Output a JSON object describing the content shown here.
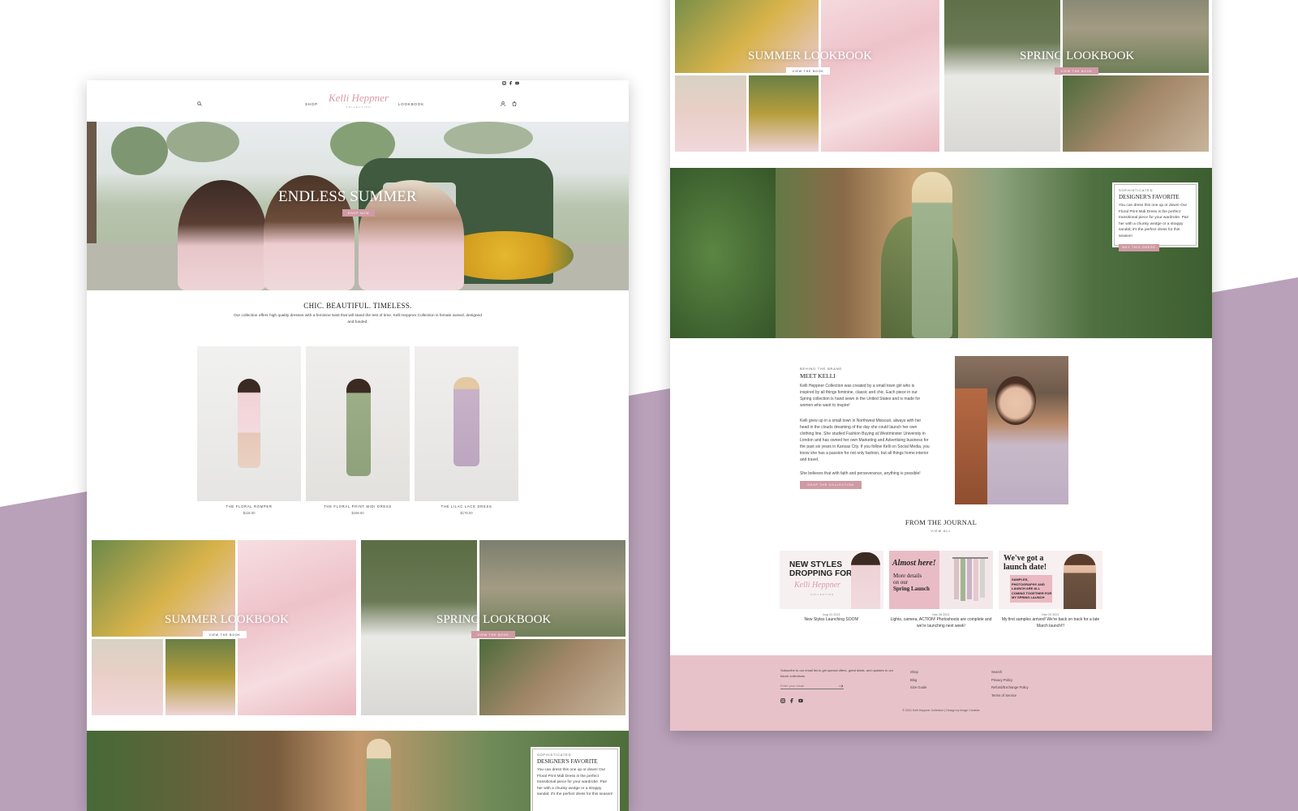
{
  "brand": {
    "logo_text": "Kelli Heppner",
    "logo_sub": "COLLECTION"
  },
  "nav": {
    "shop": "SHOP",
    "lookbook": "LOOKBOOK"
  },
  "hero": {
    "title": "ENDLESS SUMMER",
    "button": "SHOP NOW"
  },
  "intro": {
    "title": "CHIC. BEAUTIFUL. TIMELESS.",
    "body": "Our collection offers high quality dresses with a feminine twist that will stand the test of time. Kelli Heppner Collection is female owned, designed and funded."
  },
  "products": [
    {
      "name": "THE FLORAL ROMPER",
      "price": "$118.00"
    },
    {
      "name": "THE FLORAL PRINT MIDI DRESS",
      "price": "$168.00"
    },
    {
      "name": "THE LILAC LACE DRESS",
      "price": "$178.00"
    }
  ],
  "lookbooks": [
    {
      "title": "SUMMER LOOKBOOK",
      "button": "VIEW THE BOOK"
    },
    {
      "title": "SPRING LOOKBOOK",
      "button": "VIEW THE BOOK"
    }
  ],
  "featured": {
    "eyebrow": "SOPHISTICATED",
    "title": "DESIGNER'S FAVORITE",
    "body": "You can dress this one up or down! Our Floral Print Midi Dress is the perfect transitional piece for your wardrobe. Pair her with a chunky wedge or a strappy sandal; it's the perfect dress for this season!",
    "button": "BUY THIS DRESS"
  },
  "about": {
    "eyebrow": "BEHIND THE BRAND",
    "title": "MEET KELLI",
    "p1": "Kelli Heppner Collection was created by a small town girl who is inspired by all things feminine, classic and chic. Each piece in our Spring collection is hand sewn in the United States and is made for women who want to inspire!",
    "p2": "Kelli grew up in a small town in Northwest Missouri, always with her head in the clouds dreaming of the day she could launch her own clothing line. She studied Fashion Buying at Westminster University in London and has owned her own Marketing and Advertising business for the past six years in Kansas City. If you follow Kelli on Social Media, you know she has a passion for not only fashion, but all things home interior and travel.",
    "p3": "She believes that with faith and perseverance, anything is possible!",
    "button": "SHOP THE COLLECTION"
  },
  "journal": {
    "title": "FROM THE JOURNAL",
    "view_all": "VIEW ALL",
    "posts": [
      {
        "date": "Aug 31 2021",
        "title": "New Styles Launching SOON!",
        "img_l1": "NEW STYLES",
        "img_l2": "DROPPING FOR",
        "img_script": "Kelli Heppner",
        "img_sub": "COLLECTION"
      },
      {
        "date": "Mar 26 2021",
        "title": "Lights, camera, ACTION! Photoshoots are complete and we're launching next week!",
        "img_script": "Almost here!",
        "img_l1": "More details",
        "img_l2": "on our",
        "img_l3": "Spring Launch"
      },
      {
        "date": "Mar 19 2021",
        "title": "My first samples arrived! We're back on track for a late March launch!!!",
        "img_l1": "We've got a",
        "img_l2": "launch date!",
        "img_l3": "SAMPLES, PHOTOGRAPHY AND LAUNCH ARE ALL COMING TOGETHER FOR MY SPRING LAUNCH"
      }
    ]
  },
  "footer": {
    "subscribe_text": "Subscribe to our email list to get special offers, great deals, and updates to our future collections",
    "email_placeholder": "Enter your email",
    "col1": [
      "Shop",
      "Blog",
      "Size Guide"
    ],
    "col2": [
      "Search",
      "Privacy Policy",
      "Refund/Exchange Policy",
      "Terms of Service"
    ],
    "copyright": "© 2021 Kelli Heppner Collection | Design by Imagir Creative"
  },
  "colors": {
    "accent": "#d09aa4",
    "footer_bg": "#e8c2c9",
    "bg_purple": "#b9a1b9"
  },
  "icons": [
    "search-icon",
    "account-icon",
    "cart-icon",
    "instagram-icon",
    "facebook-icon",
    "youtube-icon",
    "arrow-right-icon"
  ]
}
